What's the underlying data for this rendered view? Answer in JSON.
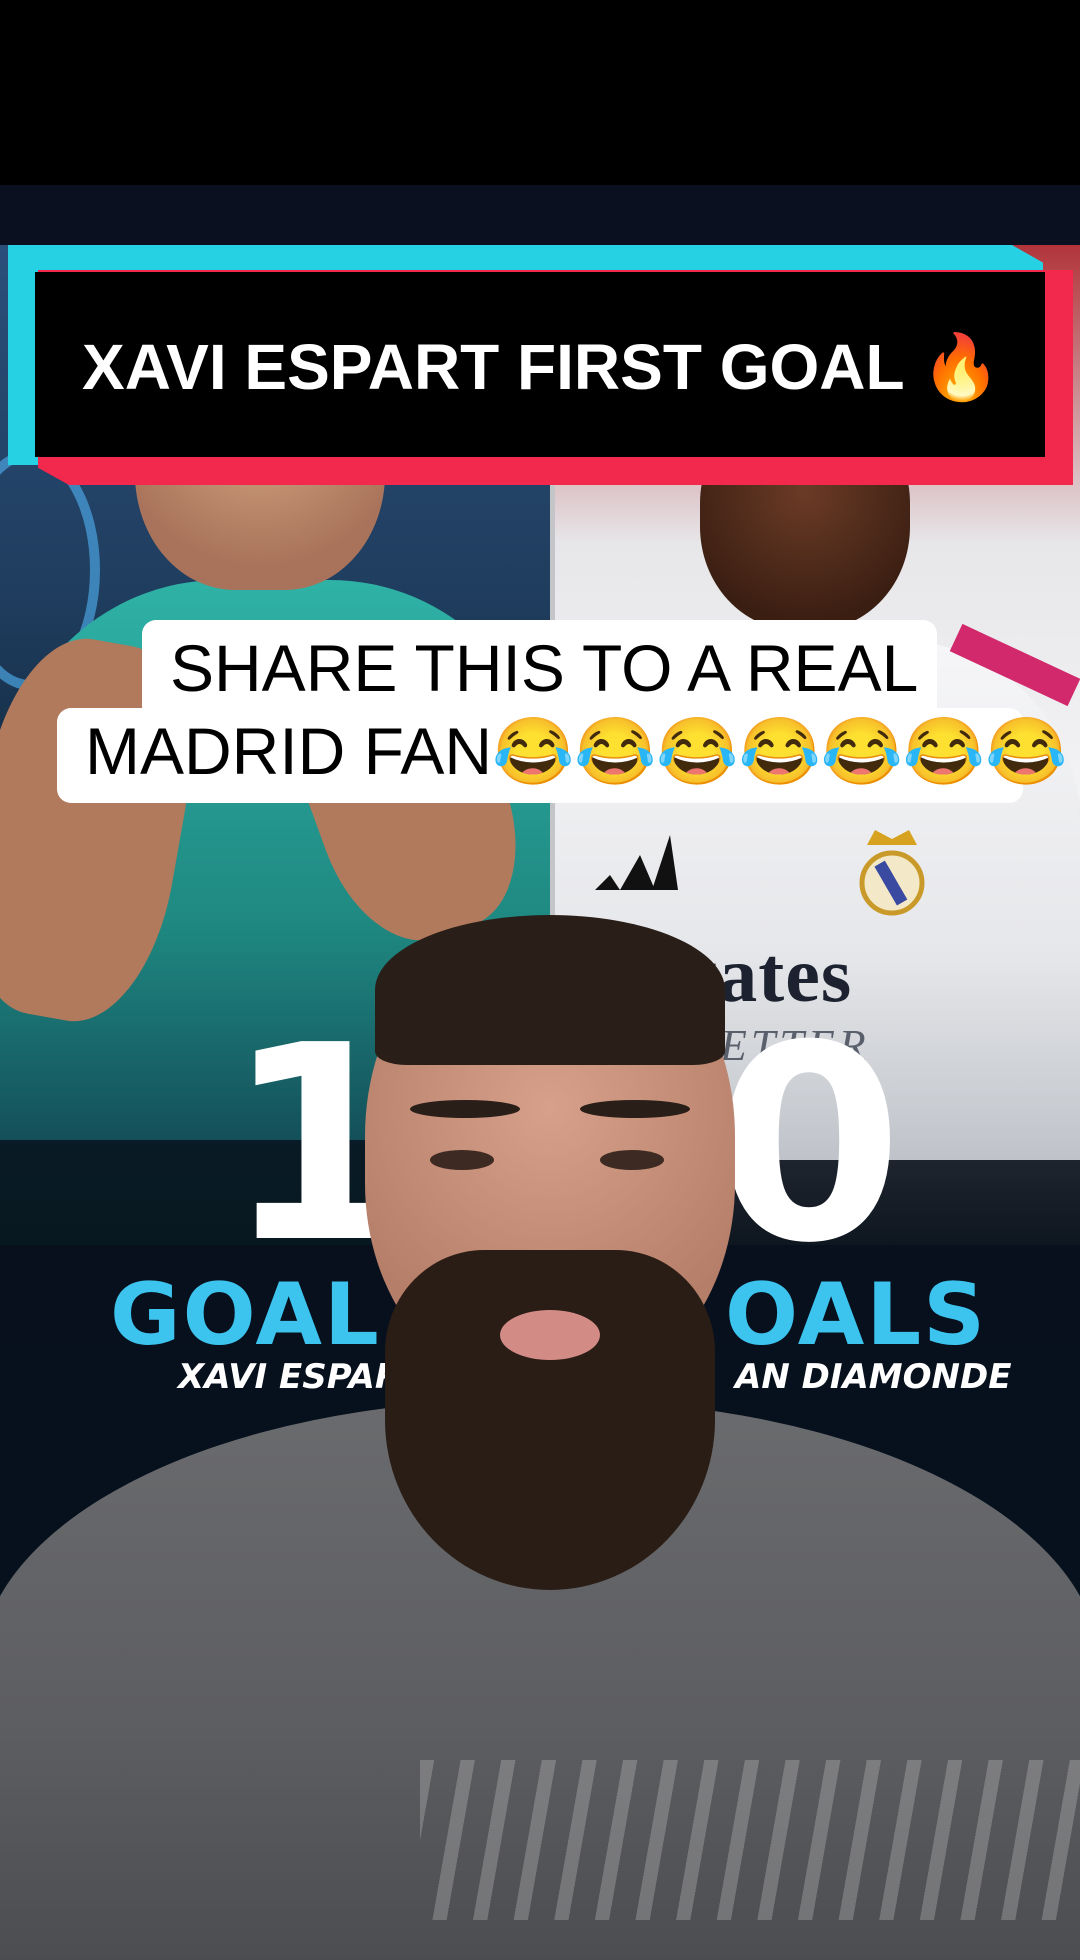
{
  "title_banner": {
    "text": "XAVI ESPART FIRST GOAL 🔥"
  },
  "caption": {
    "line1": "SHARE THIS TO A REAL",
    "line2": "MADRID FAN😂😂😂😂😂😂😂"
  },
  "graphic": {
    "left_stat": "1",
    "right_stat": "0",
    "left_label": "GOAL",
    "right_label": "OALS",
    "left_name": "XAVI ESPAR",
    "right_name": "AN DIAMONDE",
    "sponsor": "irates",
    "sponsor_sub": "ETTER"
  },
  "colors": {
    "banner_cyan": "#27d1e4",
    "banner_red": "#f2294c",
    "stat_blue": "#3cc4ef"
  }
}
